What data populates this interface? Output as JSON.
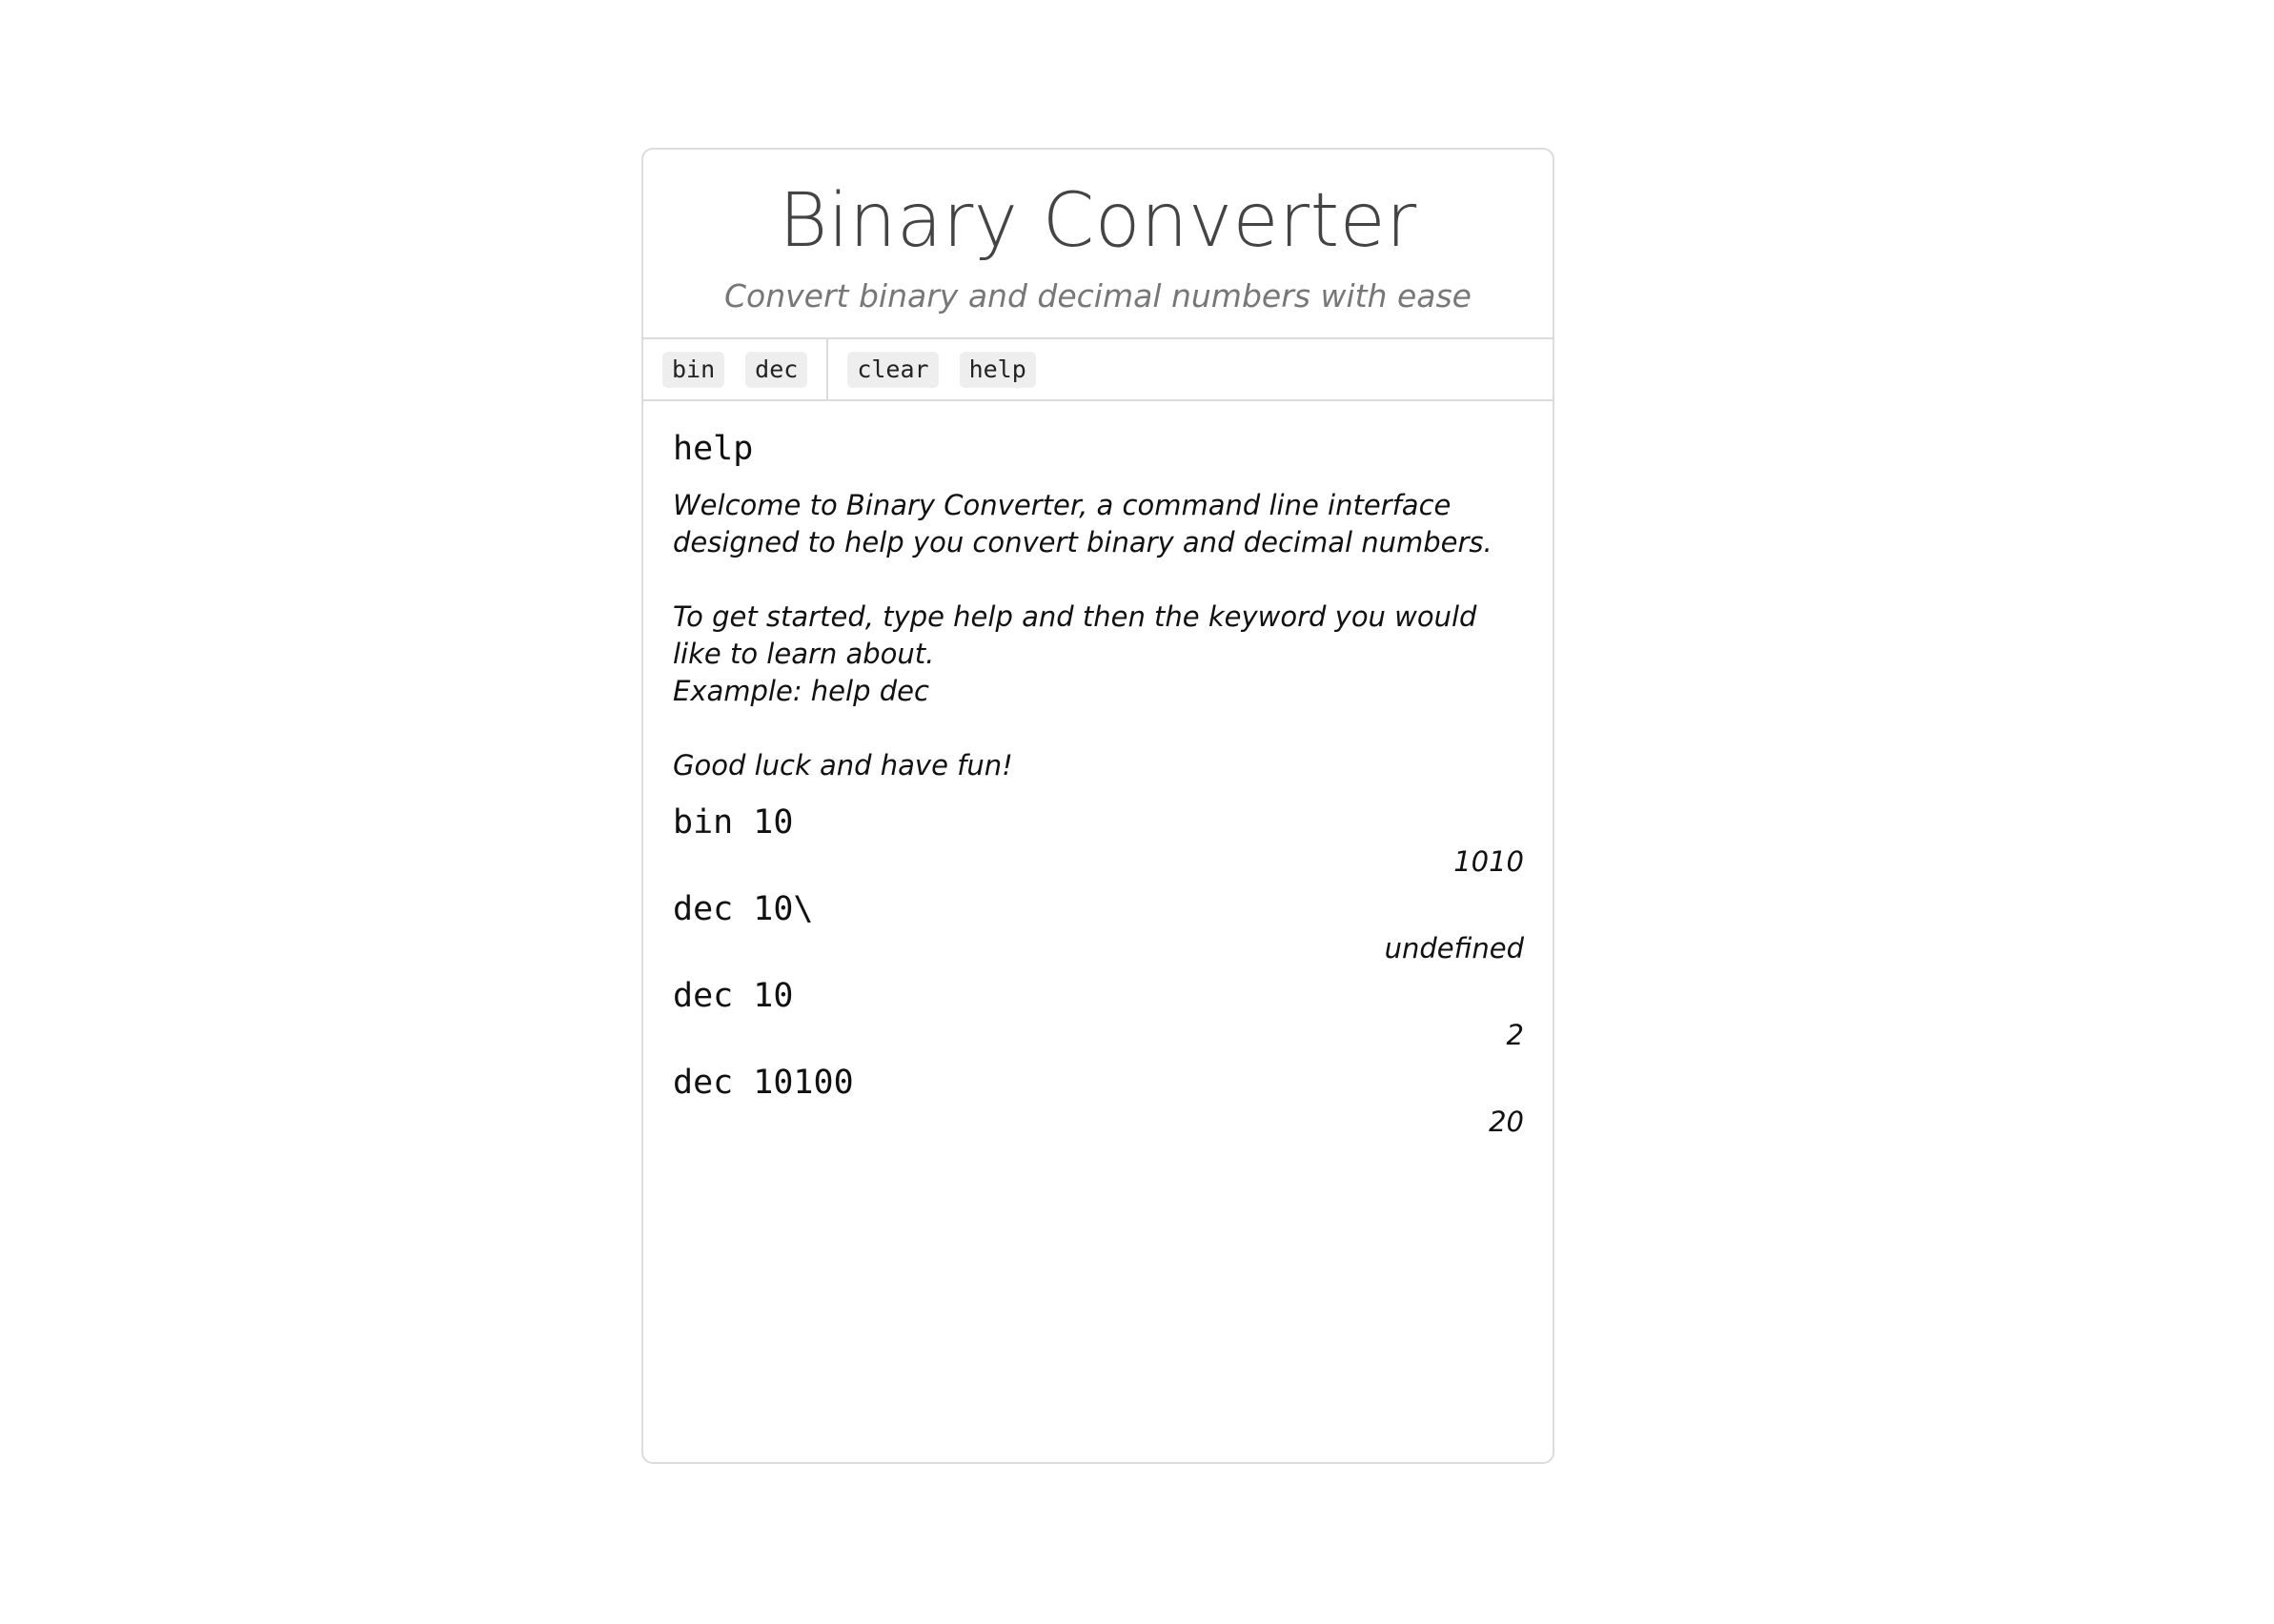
{
  "header": {
    "title": "Binary Converter",
    "subtitle": "Convert binary and decimal numbers with ease"
  },
  "toolbar": {
    "commands": [
      "bin",
      "dec"
    ],
    "utilities": [
      "clear",
      "help"
    ]
  },
  "terminal": {
    "help_command": "help",
    "help_text": {
      "line1": "Welcome to Binary Converter, a command line interface designed to help you convert binary and decimal numbers.",
      "line2": "To get started, type help and then the keyword you would like to learn about.",
      "line3": "Example: help dec",
      "line4": "Good luck and have fun!"
    },
    "entries": [
      {
        "command": "bin 10",
        "output": "1010"
      },
      {
        "command": "dec 10\\",
        "output": "undefined"
      },
      {
        "command": "dec 10",
        "output": "2"
      },
      {
        "command": "dec 10100",
        "output": "20"
      }
    ]
  }
}
